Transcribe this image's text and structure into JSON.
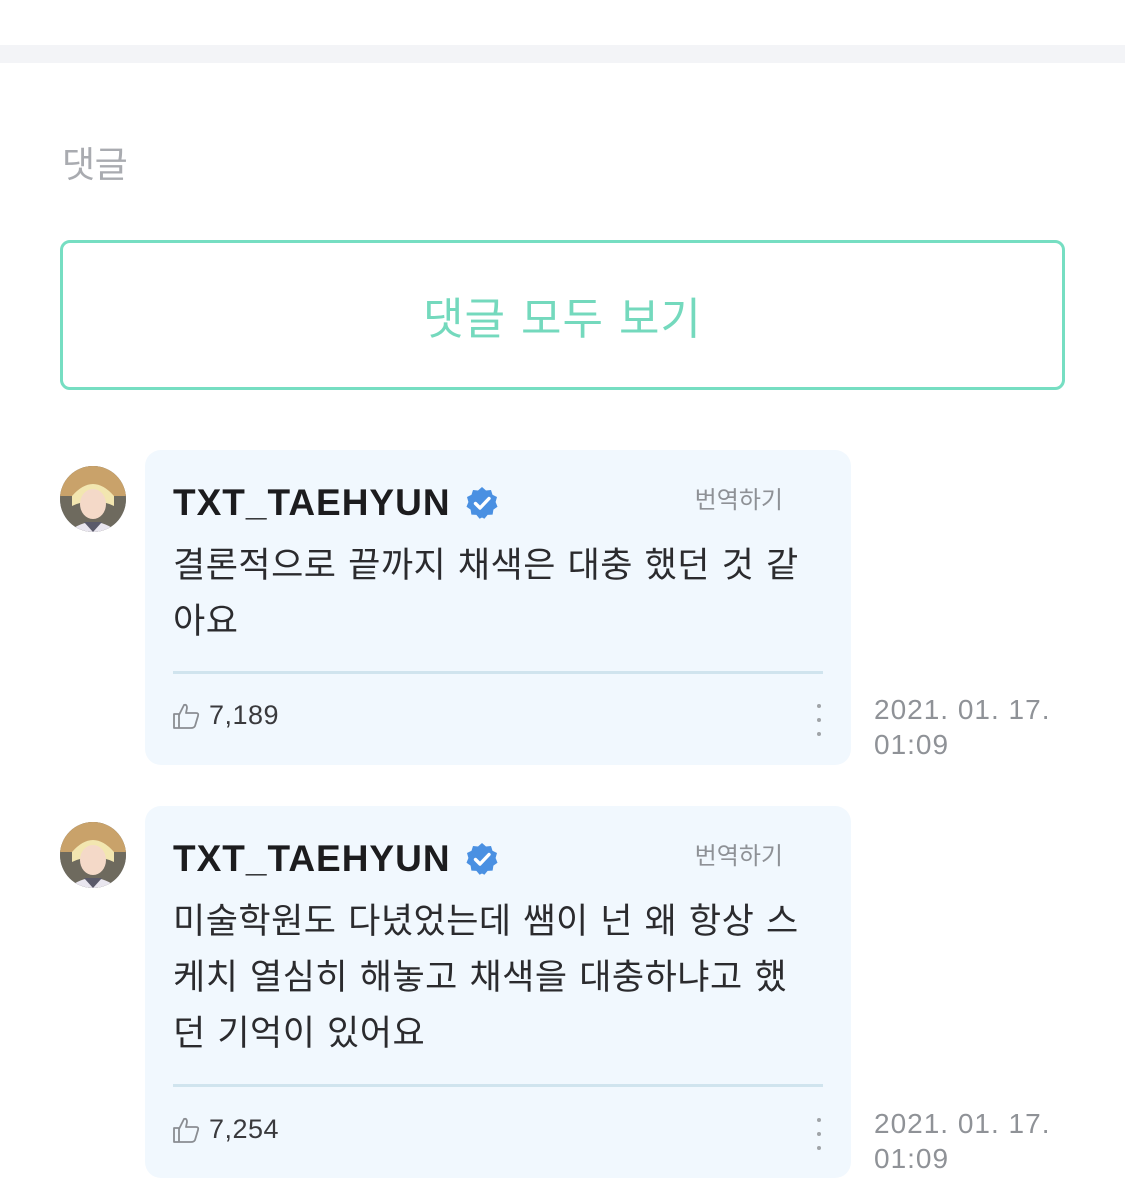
{
  "section_title": "댓글",
  "view_all_label": "댓글 모두 보기",
  "comments": [
    {
      "author": "TXT_TAEHYUN",
      "verified": true,
      "translate_label": "번역하기",
      "text": "결론적으로 끝까지 채색은 대충 했던 것 같\n아요",
      "likes": "7,189",
      "timestamp": "2021. 01. 17.\n01:09"
    },
    {
      "author": "TXT_TAEHYUN",
      "verified": true,
      "translate_label": "번역하기",
      "text": "미술학원도 다녔었는데 쌤이 넌 왜 항상 스\n케치 열심히 해놓고 채색을 대충하냐고 했\n던 기억이 있어요",
      "likes": "7,254",
      "timestamp": "2021. 01. 17.\n01:09"
    }
  ],
  "colors": {
    "accent": "#76dec2",
    "bubble_bg": "#f1f8fe",
    "verified_blue": "#4a90e2"
  },
  "icons": {
    "verified": "verified-badge-icon",
    "like": "thumbs-up-icon",
    "more": "more-vertical-icon"
  }
}
